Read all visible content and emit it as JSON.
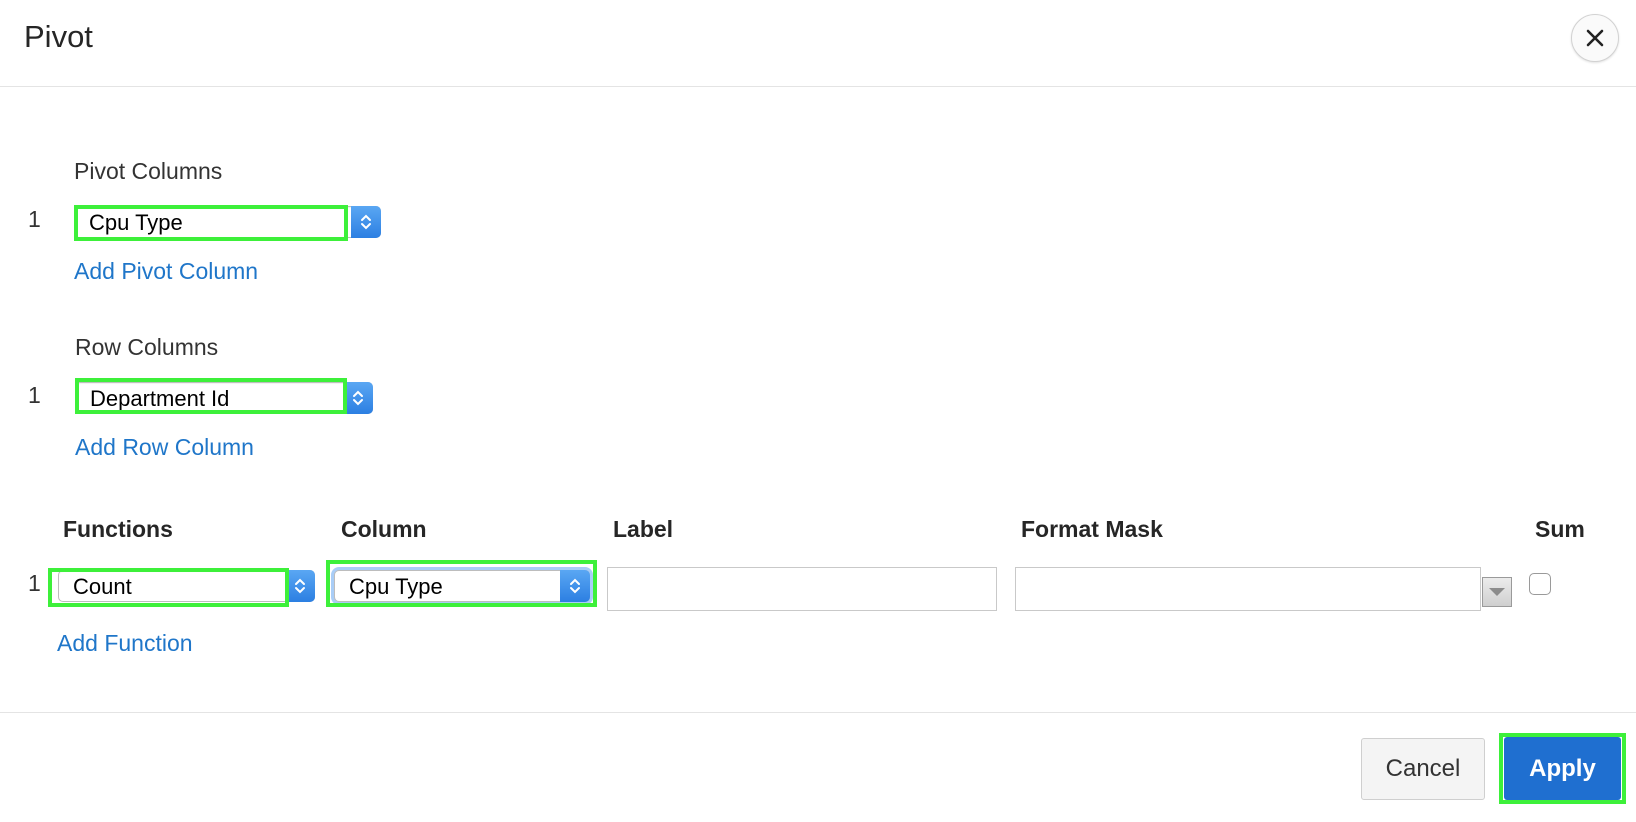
{
  "dialog": {
    "title": "Pivot",
    "close_icon": "close-icon"
  },
  "pivot_columns": {
    "label": "Pivot Columns",
    "rows": [
      {
        "index": "1",
        "value": "Cpu Type"
      }
    ],
    "add_link": "Add Pivot Column"
  },
  "row_columns": {
    "label": "Row Columns",
    "rows": [
      {
        "index": "1",
        "value": "Department Id"
      }
    ],
    "add_link": "Add Row Column"
  },
  "functions": {
    "headers": {
      "function": "Functions",
      "column": "Column",
      "label": "Label",
      "format_mask": "Format Mask",
      "sum": "Sum"
    },
    "rows": [
      {
        "index": "1",
        "function": "Count",
        "column": "Cpu Type",
        "label": "",
        "format_mask": "",
        "sum": false
      }
    ],
    "add_link": "Add Function"
  },
  "footer": {
    "cancel_label": "Cancel",
    "apply_label": "Apply"
  },
  "colors": {
    "link": "#1f76c9",
    "primary": "#1f6fd0",
    "highlight": "#3df03a"
  }
}
